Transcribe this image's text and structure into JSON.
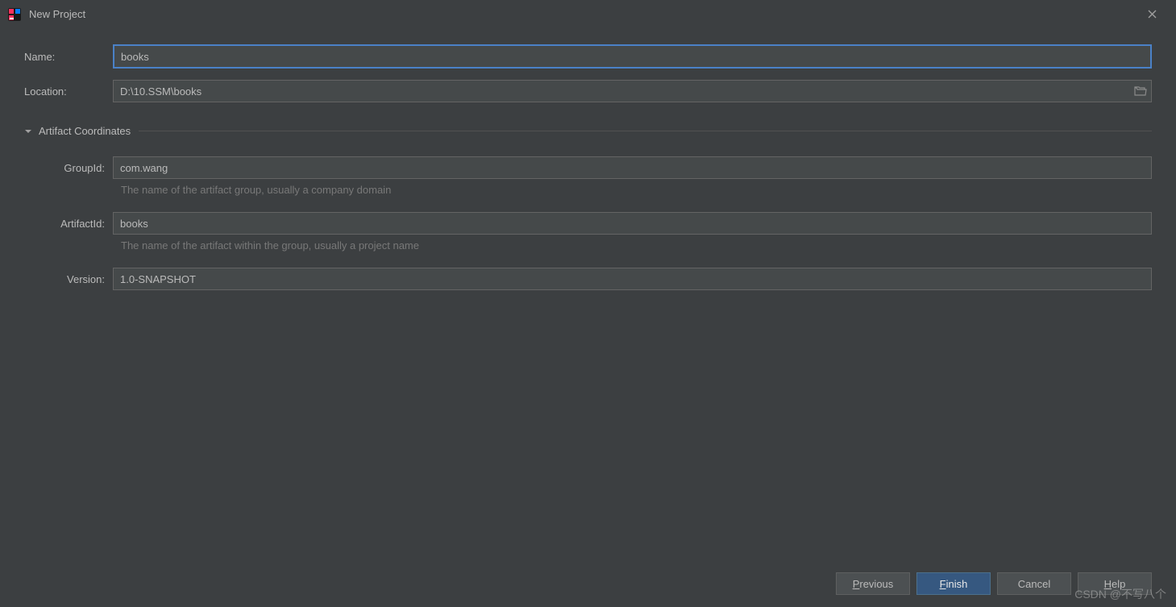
{
  "window": {
    "title": "New Project"
  },
  "form": {
    "name_label": "Name:",
    "name_value": "books",
    "location_label": "Location:",
    "location_value": "D:\\10.SSM\\books"
  },
  "artifact": {
    "header": "Artifact Coordinates",
    "group_label": "GroupId:",
    "group_value": "com.wang",
    "group_hint": "The name of the artifact group, usually a company domain",
    "artifact_label": "ArtifactId:",
    "artifact_value": "books",
    "artifact_hint": "The name of the artifact within the group, usually a project name",
    "version_label": "Version:",
    "version_value": "1.0-SNAPSHOT"
  },
  "buttons": {
    "previous_mn": "P",
    "previous_rest": "revious",
    "finish_mn": "F",
    "finish_rest": "inish",
    "cancel": "Cancel",
    "help_pre": "H",
    "help_rest": "elp"
  },
  "watermark": "CSDN @不写八个"
}
